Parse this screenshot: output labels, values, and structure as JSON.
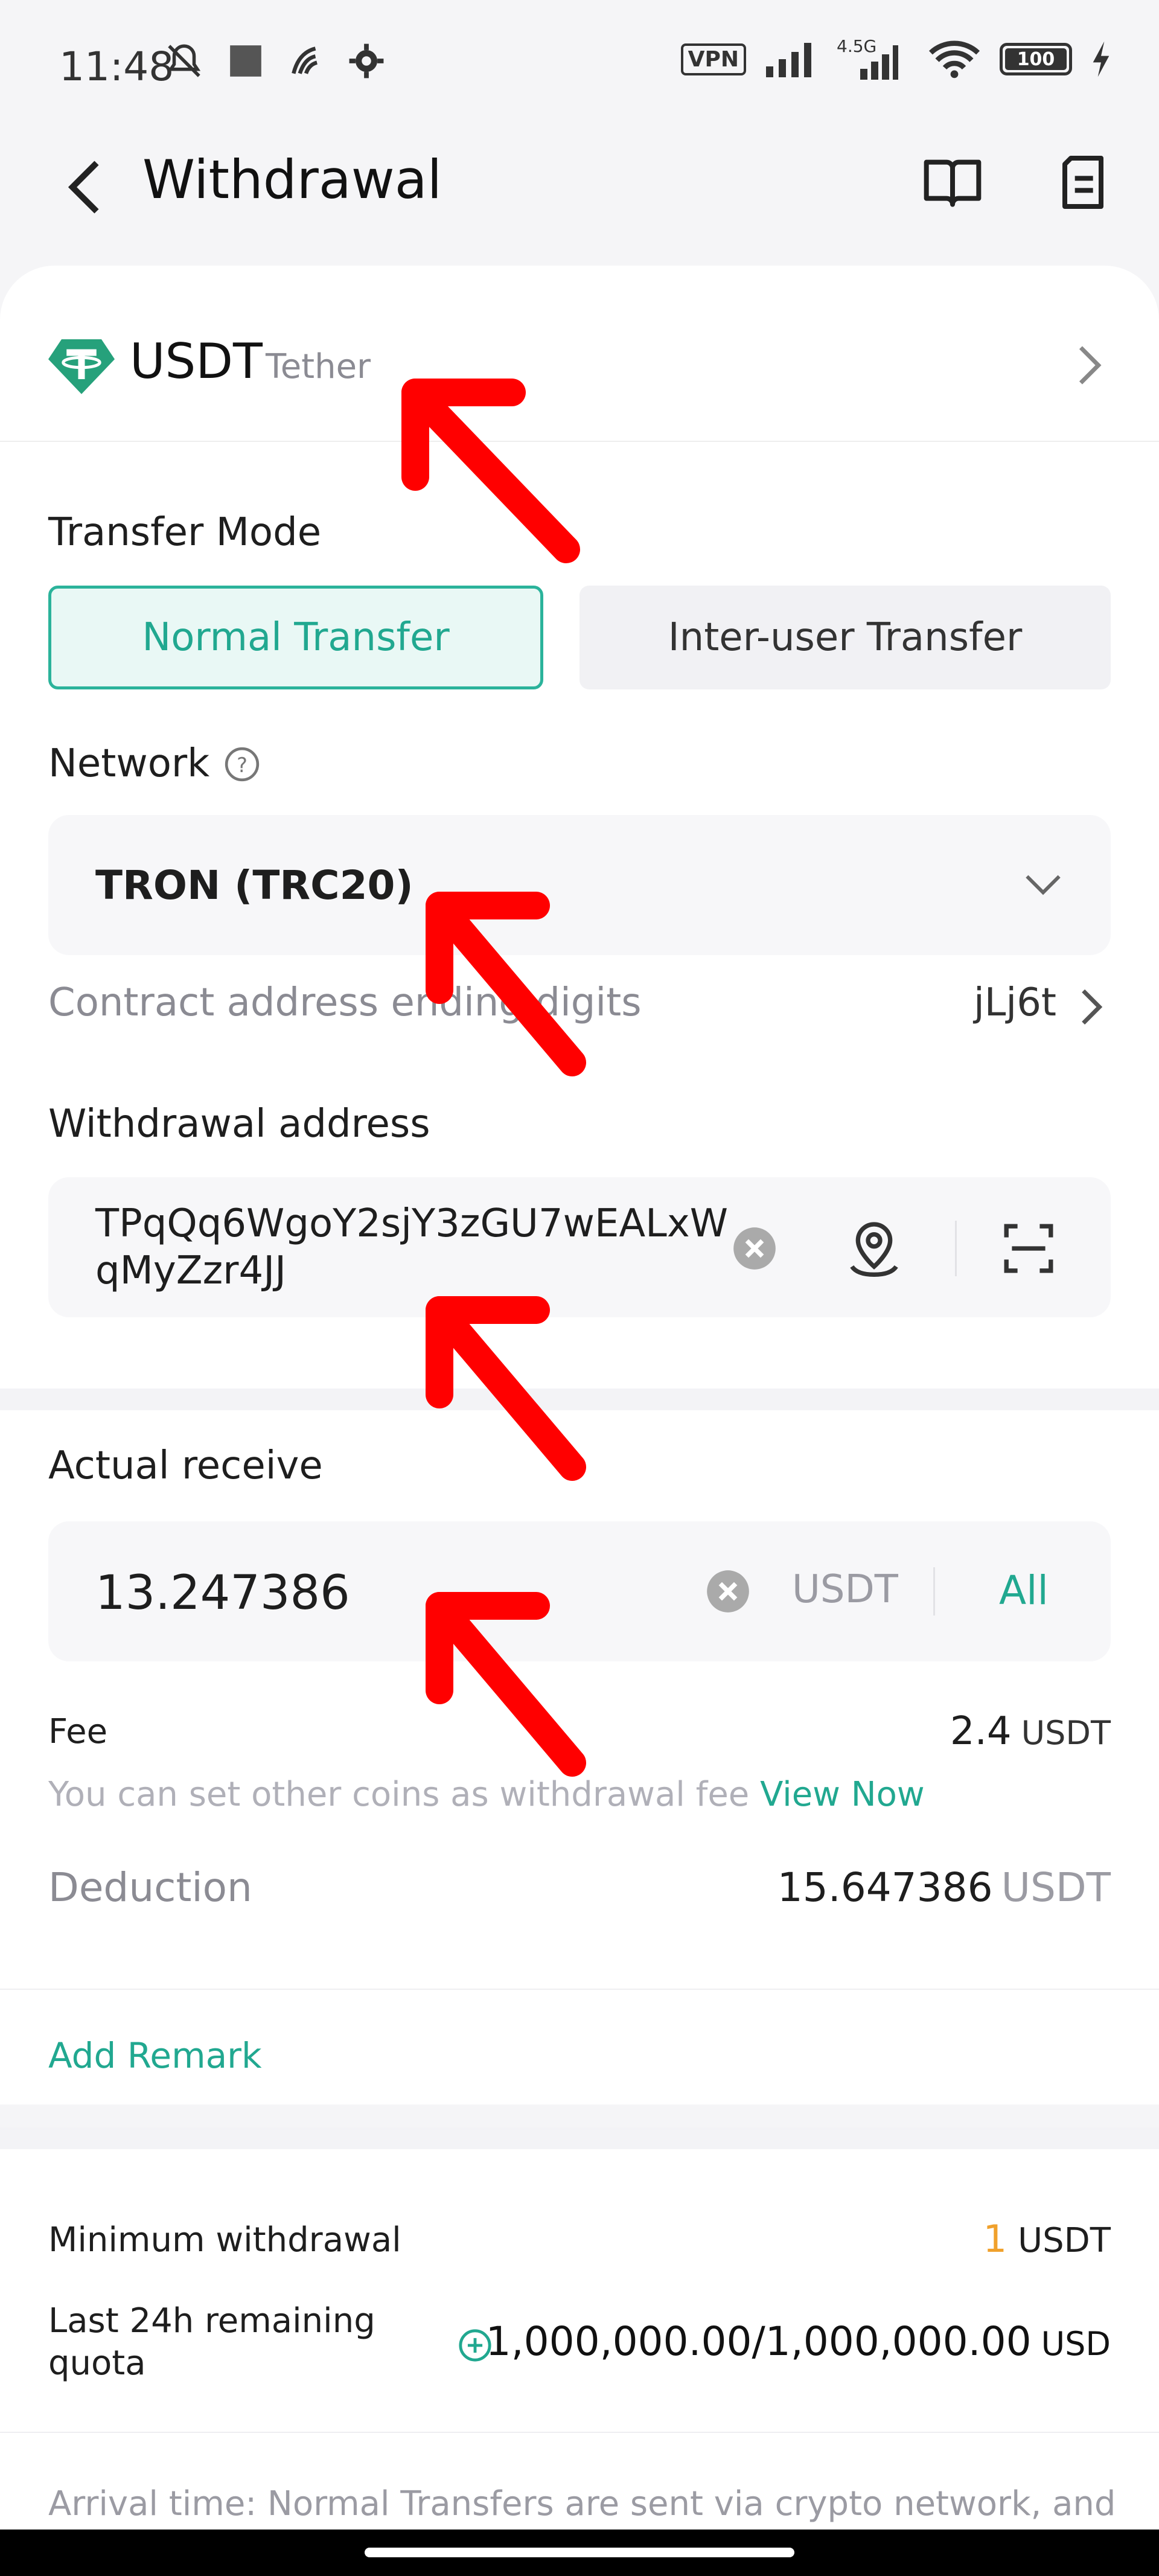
{
  "status_bar": {
    "time": "11:48",
    "vpn": "VPN",
    "network_type": "4.5G",
    "battery": "100"
  },
  "header": {
    "title": "Withdrawal"
  },
  "coin": {
    "symbol": "USDT",
    "name": "Tether"
  },
  "transfer_mode": {
    "label": "Transfer Mode",
    "options": [
      "Normal Transfer",
      "Inter-user Transfer"
    ],
    "selected": "Normal Transfer"
  },
  "network": {
    "label": "Network",
    "value": "TRON (TRC20)",
    "contract_label": "Contract address ending digits",
    "contract_value": "jLj6t"
  },
  "withdrawal_address": {
    "label": "Withdrawal address",
    "value": "TPqQq6WgoY2sjY3zGU7wEALxWqMyZzr4JJ"
  },
  "actual_receive": {
    "label": "Actual receive",
    "value": "13.247386",
    "unit": "USDT",
    "all_label": "All"
  },
  "fee": {
    "label": "Fee",
    "value": "2.4",
    "unit": "USDT",
    "hint": "You can set other coins as withdrawal fee",
    "hint_link": "View Now"
  },
  "deduction": {
    "label": "Deduction",
    "value": "15.647386",
    "unit": "USDT"
  },
  "remark": {
    "label": "Add Remark"
  },
  "limits": {
    "min_label": "Minimum withdrawal",
    "min_value": "1",
    "min_unit": "USDT",
    "quota_label": "Last 24h remaining quota",
    "quota_value": "1,000,000.00/1,000,000.00",
    "quota_unit": "USD"
  },
  "arrival_note": "Arrival time: Normal Transfers are sent via crypto network, and",
  "colors": {
    "accent": "#21a890",
    "annotation_arrow": "#ff0000",
    "min_value": "#f0a12c"
  }
}
